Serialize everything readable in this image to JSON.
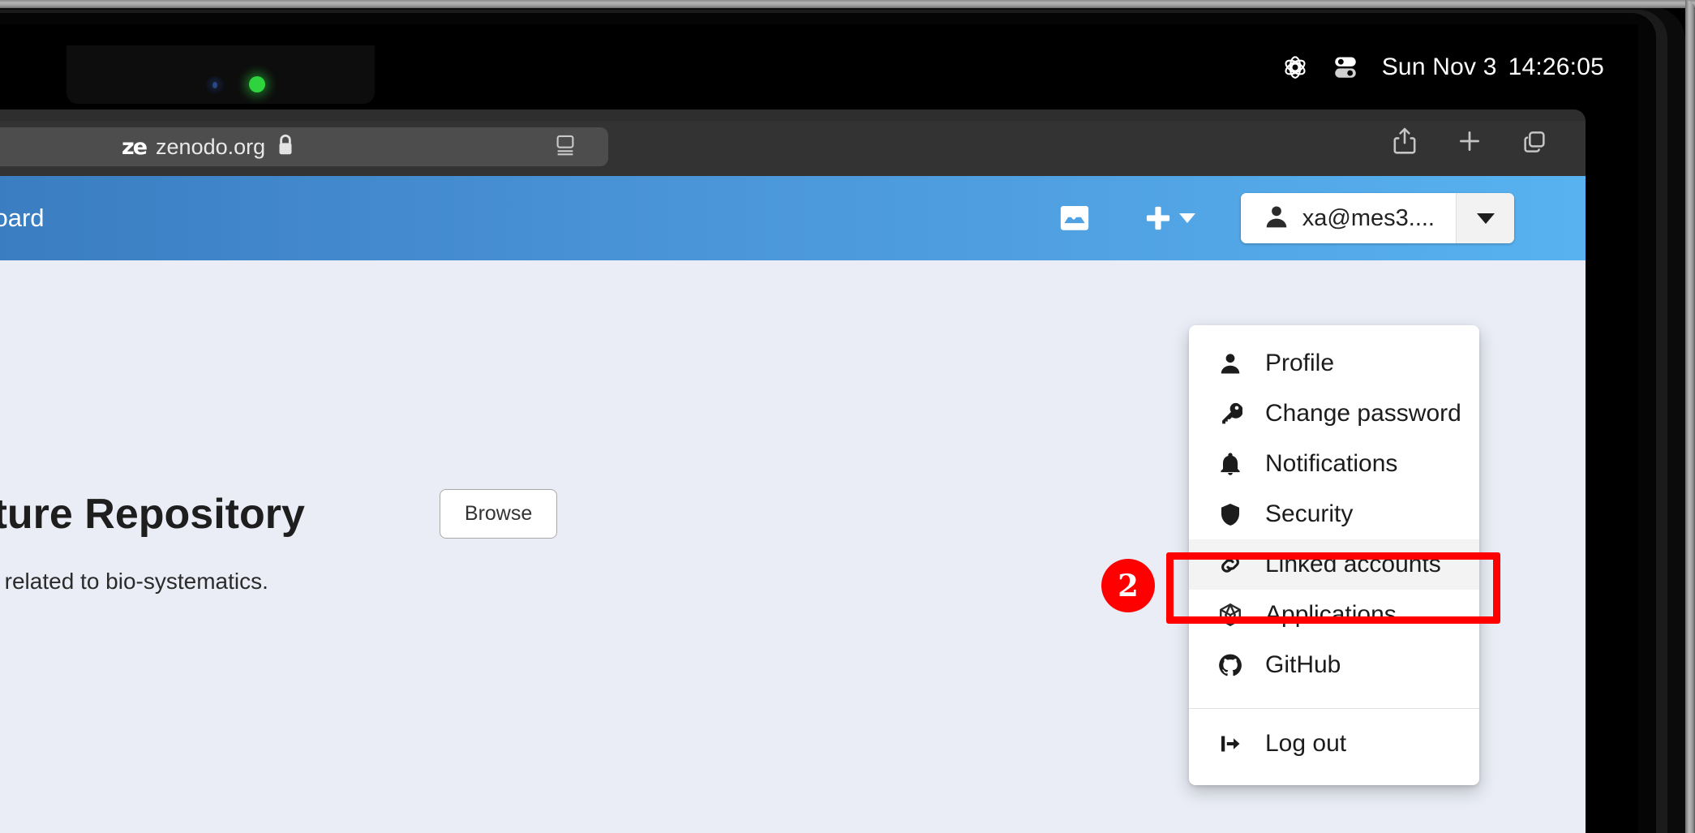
{
  "macos": {
    "status_icons": [
      "control-center-icon",
      "toggle-icon"
    ],
    "date": "Sun Nov 3",
    "time": "14:26:05"
  },
  "browser": {
    "favicon_text": "ze",
    "url": "zenodo.org",
    "lock_icon": "lock-icon",
    "reader_icon": "reader-view-icon",
    "actions": [
      "share-icon",
      "new-tab-icon",
      "tab-overview-icon"
    ]
  },
  "zenodo": {
    "header": {
      "title": "dashboard",
      "inbox_icon": "inbox-icon",
      "upload_icon": "plus-icon",
      "user": {
        "label": "xa@mes3....",
        "avatar_icon": "person-icon",
        "caret_icon": "chevron-down-icon"
      }
    },
    "content": {
      "title": "Literature Repository",
      "browse_label": "Browse",
      "subtitle": "publications related to bio-systematics."
    },
    "dropdown": {
      "items": [
        {
          "label": "Profile",
          "icon": "person-icon"
        },
        {
          "label": "Change password",
          "icon": "key-icon"
        },
        {
          "label": "Notifications",
          "icon": "bell-icon"
        },
        {
          "label": "Security",
          "icon": "shield-icon"
        },
        {
          "label": "Linked accounts",
          "icon": "link-icon"
        },
        {
          "label": "Applications",
          "icon": "cube-icon"
        },
        {
          "label": "GitHub",
          "icon": "github-icon"
        }
      ],
      "logout": {
        "label": "Log out",
        "icon": "sign-out-icon"
      },
      "active_index": 4
    }
  },
  "annotation": {
    "badge_number": "2",
    "color": "#ff0000",
    "target": "Linked accounts"
  }
}
